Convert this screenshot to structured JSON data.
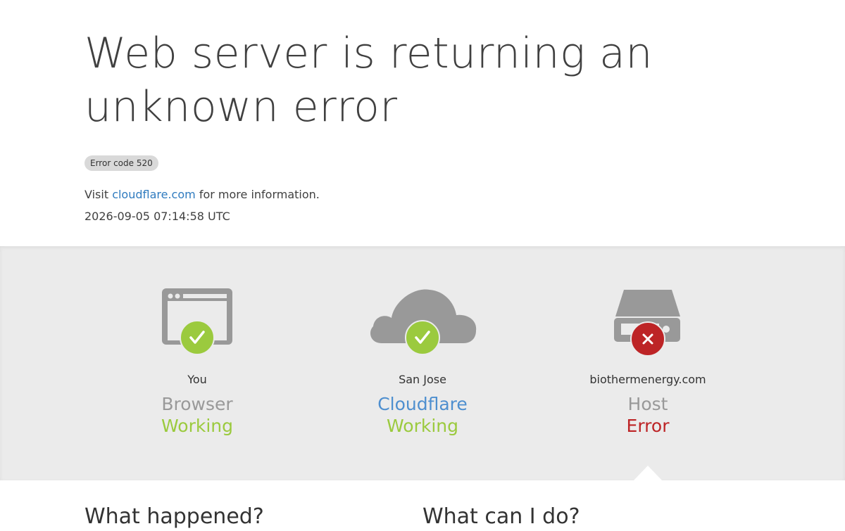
{
  "header": {
    "title": "Web server is returning an unknown error",
    "error_code": "Error code 520",
    "visit_prefix": "Visit ",
    "visit_link": "cloudflare.com",
    "visit_suffix": " for more information.",
    "timestamp": "2026-09-05 07:14:58 UTC"
  },
  "nodes": [
    {
      "location": "You",
      "type": "Browser",
      "state": "Working",
      "icon": "browser-icon",
      "badge": "checkmark-icon"
    },
    {
      "location": "San Jose",
      "type": "Cloudflare",
      "state": "Working",
      "icon": "cloud-icon",
      "badge": "checkmark-icon"
    },
    {
      "location": "biothermenergy.com",
      "type": "Host",
      "state": "Error",
      "icon": "server-icon",
      "badge": "error-x-icon"
    }
  ],
  "sections": {
    "what_happened": "What happened?",
    "what_can_i_do": "What can I do?"
  },
  "colors": {
    "working": "#9bca3e",
    "error": "#bd2426",
    "link": "#2f7bbf",
    "icon_gray": "#999999",
    "status_bg": "#ebebeb"
  }
}
